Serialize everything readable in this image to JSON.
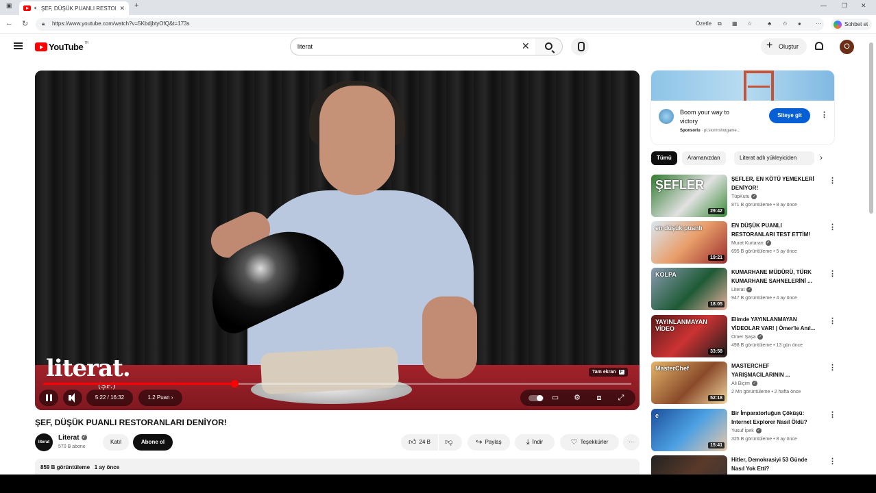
{
  "browser": {
    "tab_title": "ŞEF, DÜŞÜK PUANLI RESTORA...",
    "url": "https://www.youtube.com/watch?v=5KbdjbtyOfQ&t=173s",
    "summarize_label": "Özetle",
    "copilot_label": "Sohbet et"
  },
  "yt_header": {
    "logo_text": "YouTube",
    "logo_country": "TR",
    "search_value": "literat",
    "create_label": "Oluştur",
    "avatar_letter": "O"
  },
  "player": {
    "watermark": "literat.",
    "watermark_sub": "(ŞF.)",
    "fullscreen_tooltip": "Tam ekran",
    "fullscreen_key": "F",
    "time_display": "5:22 / 16:32",
    "chapter_label": "1.2 Puan ›",
    "progress_fraction": 0.325
  },
  "video": {
    "title": "ŞEF, DÜŞÜK PUANLI RESTORANLARI DENİYOR!",
    "channel_name": "Literat",
    "channel_avatar_text": "literat",
    "subscribers": "570 B abone",
    "join_label": "Katıl",
    "subscribe_label": "Abone ol",
    "likes": "24 B",
    "share_label": "Paylaş",
    "download_label": "İndir",
    "thanks_label": "Teşekkürler",
    "views": "859 B görüntüleme",
    "uploaded": "1 ay önce"
  },
  "ad": {
    "title": "Boom your way to victory",
    "sponsored": "Sponsorlu",
    "domain": "pl.stormshotgame...",
    "cta": "Siteye git"
  },
  "chips": [
    {
      "label": "Tümü"
    },
    {
      "label": "Aramanızdan"
    },
    {
      "label": "Literat adlı yükleyiciden"
    }
  ],
  "recommendations": [
    {
      "title": "ŞEFLER, EN KÖTÜ YEMEKLERİ DENİYOR!",
      "channel": "TüpKutu",
      "meta": "871 B görüntüleme • 8 ay önce",
      "duration": "29:42",
      "thumb_text": "ŞEFLER"
    },
    {
      "title": "EN DÜŞÜK PUANLI RESTORANLARI TEST ETTİM!",
      "channel": "Murat Kurtaran",
      "meta": "695 B görüntüleme • 5 ay önce",
      "duration": "19:21",
      "thumb_text": "en düşük puanlı"
    },
    {
      "title": "KUMARHANE MÜDÜRÜ, TÜRK KUMARHANE SAHNELERİNİ ...",
      "channel": "Literat",
      "meta": "947 B görüntüleme • 4 ay önce",
      "duration": "18:05",
      "thumb_text": "KOLPA"
    },
    {
      "title": "Elimde YAYINLANMAYAN VİDEOLAR VAR! | Ömer'le Anıl...",
      "channel": "Ömer Şaşa",
      "meta": "498 B görüntüleme • 13 gün önce",
      "duration": "33:58",
      "thumb_text": "YAYINLANMAYAN VİDEO"
    },
    {
      "title": "MASTERCHEF YARIŞMACILARININ ...",
      "channel": "Ali Biçim",
      "meta": "2 Mn görüntüleme • 2 hafta önce",
      "duration": "52:18",
      "thumb_text": "MasterChef"
    },
    {
      "title": "Bir İmparatorluğun Çöküşü: Internet Explorer Nasıl Öldü?",
      "channel": "Yusuf İpek",
      "meta": "325 B görüntüleme • 8 ay önce",
      "duration": "15:41",
      "thumb_text": "e"
    },
    {
      "title": "Hitler, Demokrasiyi 53 Günde Nasıl Yok Etti?",
      "channel": "",
      "meta": "",
      "duration": "",
      "thumb_text": ""
    }
  ]
}
